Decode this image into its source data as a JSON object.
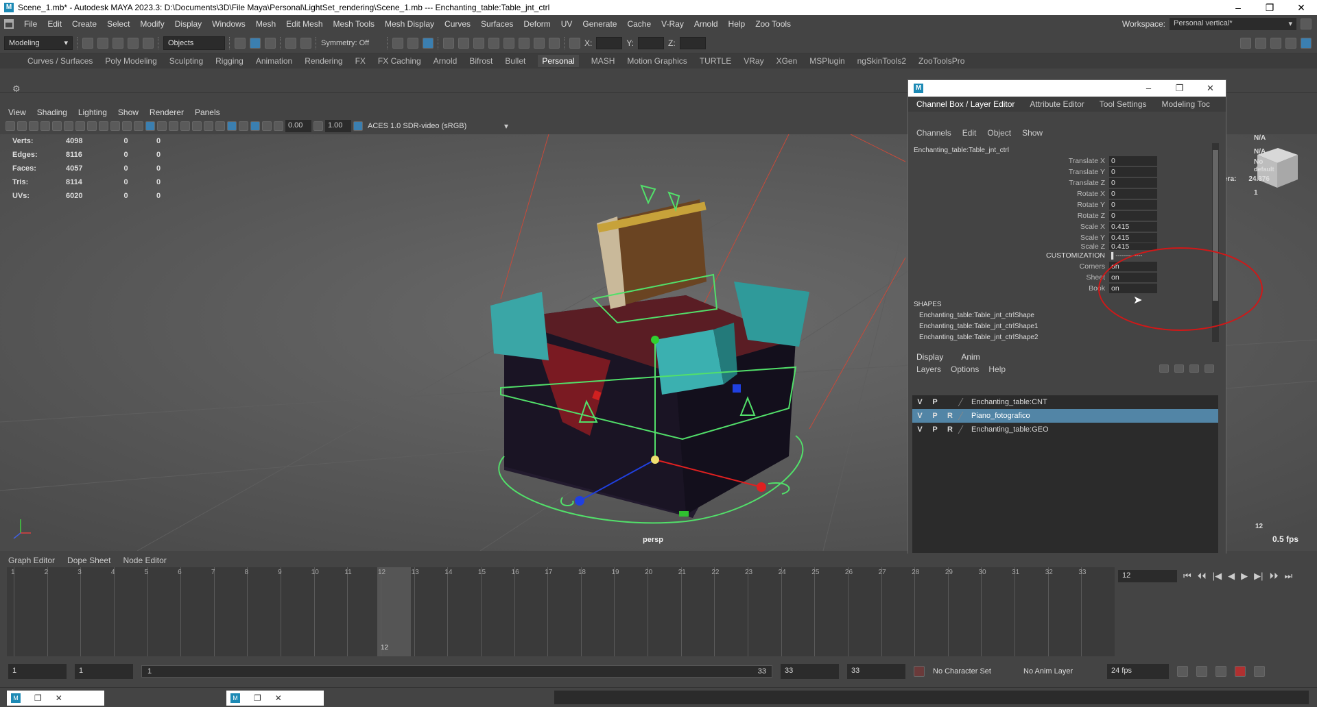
{
  "window": {
    "title": "Scene_1.mb* - Autodesk MAYA 2023.3: D:\\Documents\\3D\\File Maya\\Personal\\LightSet_rendering\\Scene_1.mb  ---  Enchanting_table:Table_jnt_ctrl",
    "app_icon": "M",
    "controls": [
      "–",
      "❐",
      "✕"
    ]
  },
  "menubar": {
    "items": [
      "File",
      "Edit",
      "Create",
      "Select",
      "Modify",
      "Display",
      "Windows",
      "Mesh",
      "Edit Mesh",
      "Mesh Tools",
      "Mesh Display",
      "Curves",
      "Surfaces",
      "Deform",
      "UV",
      "Generate",
      "Cache",
      "V-Ray",
      "Arnold",
      "Help",
      "Zoo Tools"
    ],
    "workspace_label": "Workspace:",
    "workspace_value": "Personal vertical*"
  },
  "statusline": {
    "mode": "Modeling",
    "selection": "Objects",
    "symmetry": "Symmetry: Off",
    "x_label": "X:",
    "y_label": "Y:",
    "z_label": "Z:"
  },
  "shelf_tabs": [
    "Curves / Surfaces",
    "Poly Modeling",
    "Sculpting",
    "Rigging",
    "Animation",
    "Rendering",
    "FX",
    "FX Caching",
    "Arnold",
    "Bifrost",
    "Bullet",
    "Personal",
    "MASH",
    "Motion Graphics",
    "TURTLE",
    "VRay",
    "XGen",
    "MSPlugin",
    "ngSkinTools2",
    "ZooToolsPro"
  ],
  "active_shelf": "Personal",
  "viewport": {
    "menu": [
      "View",
      "Shading",
      "Lighting",
      "Show",
      "Renderer",
      "Panels"
    ],
    "exposure": "0.00",
    "gamma": "1.00",
    "colorspace": "ACES 1.0 SDR-video (sRGB)",
    "hud": [
      {
        "label": "Verts:",
        "a": "4098",
        "b": "0",
        "c": "0"
      },
      {
        "label": "Edges:",
        "a": "8116",
        "b": "0",
        "c": "0"
      },
      {
        "label": "Faces:",
        "a": "4057",
        "b": "0",
        "c": "0"
      },
      {
        "label": "Tris:",
        "a": "8114",
        "b": "0",
        "c": "0"
      },
      {
        "label": "UVs:",
        "a": "6020",
        "b": "0",
        "c": "0"
      }
    ],
    "camera": "persp",
    "fps": "0.5 fps",
    "right_hud": [
      "N/A",
      "N/A",
      "No",
      "default",
      "era:",
      "24.376",
      "1"
    ],
    "frame_readout": "12"
  },
  "channel_box": {
    "tabs": [
      "Channel Box / Layer Editor",
      "Attribute Editor",
      "Tool Settings",
      "Modeling Toc"
    ],
    "menu": [
      "Channels",
      "Edit",
      "Object",
      "Show"
    ],
    "object": "Enchanting_table:Table_jnt_ctrl",
    "attributes": [
      {
        "name": "Translate X",
        "value": "0"
      },
      {
        "name": "Translate Y",
        "value": "0"
      },
      {
        "name": "Translate Z",
        "value": "0"
      },
      {
        "name": "Rotate X",
        "value": "0"
      },
      {
        "name": "Rotate Y",
        "value": "0"
      },
      {
        "name": "Rotate Z",
        "value": "0"
      },
      {
        "name": "Scale X",
        "value": "0.415"
      },
      {
        "name": "Scale Y",
        "value": "0.415"
      },
      {
        "name": "Scale Z",
        "value": "0.415"
      },
      {
        "name": "CUSTOMIZATION",
        "value": "▌-------------"
      },
      {
        "name": "Corners",
        "value": "on"
      },
      {
        "name": "Sheet",
        "value": "on"
      },
      {
        "name": "Book",
        "value": "on"
      }
    ],
    "shapes_header": "SHAPES",
    "shapes": [
      "Enchanting_table:Table_jnt_ctrlShape",
      "Enchanting_table:Table_jnt_ctrlShape1",
      "Enchanting_table:Table_jnt_ctrlShape2"
    ],
    "layer_tabs": [
      "Display",
      "Anim"
    ],
    "layer_menu": [
      "Layers",
      "Options",
      "Help"
    ],
    "layers": [
      {
        "v": "V",
        "p": "P",
        "r": "",
        "name": "Enchanting_table:CNT",
        "selected": false
      },
      {
        "v": "V",
        "p": "P",
        "r": "R",
        "name": "Piano_fotografico",
        "selected": true
      },
      {
        "v": "V",
        "p": "P",
        "r": "R",
        "name": "Enchanting_table:GEO",
        "selected": false
      }
    ]
  },
  "bottom_tabs": [
    "Graph Editor",
    "Dope Sheet",
    "Node Editor"
  ],
  "timeline": {
    "frames": [
      "1",
      "2",
      "3",
      "4",
      "5",
      "6",
      "7",
      "8",
      "9",
      "10",
      "11",
      "12",
      "13",
      "14",
      "15",
      "16",
      "17",
      "18",
      "19",
      "20",
      "21",
      "22",
      "23",
      "24",
      "25",
      "26",
      "27",
      "28",
      "29",
      "30",
      "31",
      "32",
      "33"
    ],
    "current": "12"
  },
  "playback": {
    "current_frame": "12",
    "buttons": [
      "⏮",
      "⏴⏴",
      "|◀",
      "◀",
      "▶",
      "▶|",
      "⏵⏵",
      "⏭"
    ]
  },
  "range": {
    "start": "1",
    "inner_start": "1",
    "slider_start": "1",
    "slider_end": "33",
    "inner_end": "33",
    "end": "33",
    "character_set": "No Character Set",
    "anim_layer": "No Anim Layer",
    "fps": "24 fps"
  },
  "colors": {
    "selection": "#5285a6",
    "annotation": "#d01818",
    "accent": "#1d8ab5"
  }
}
